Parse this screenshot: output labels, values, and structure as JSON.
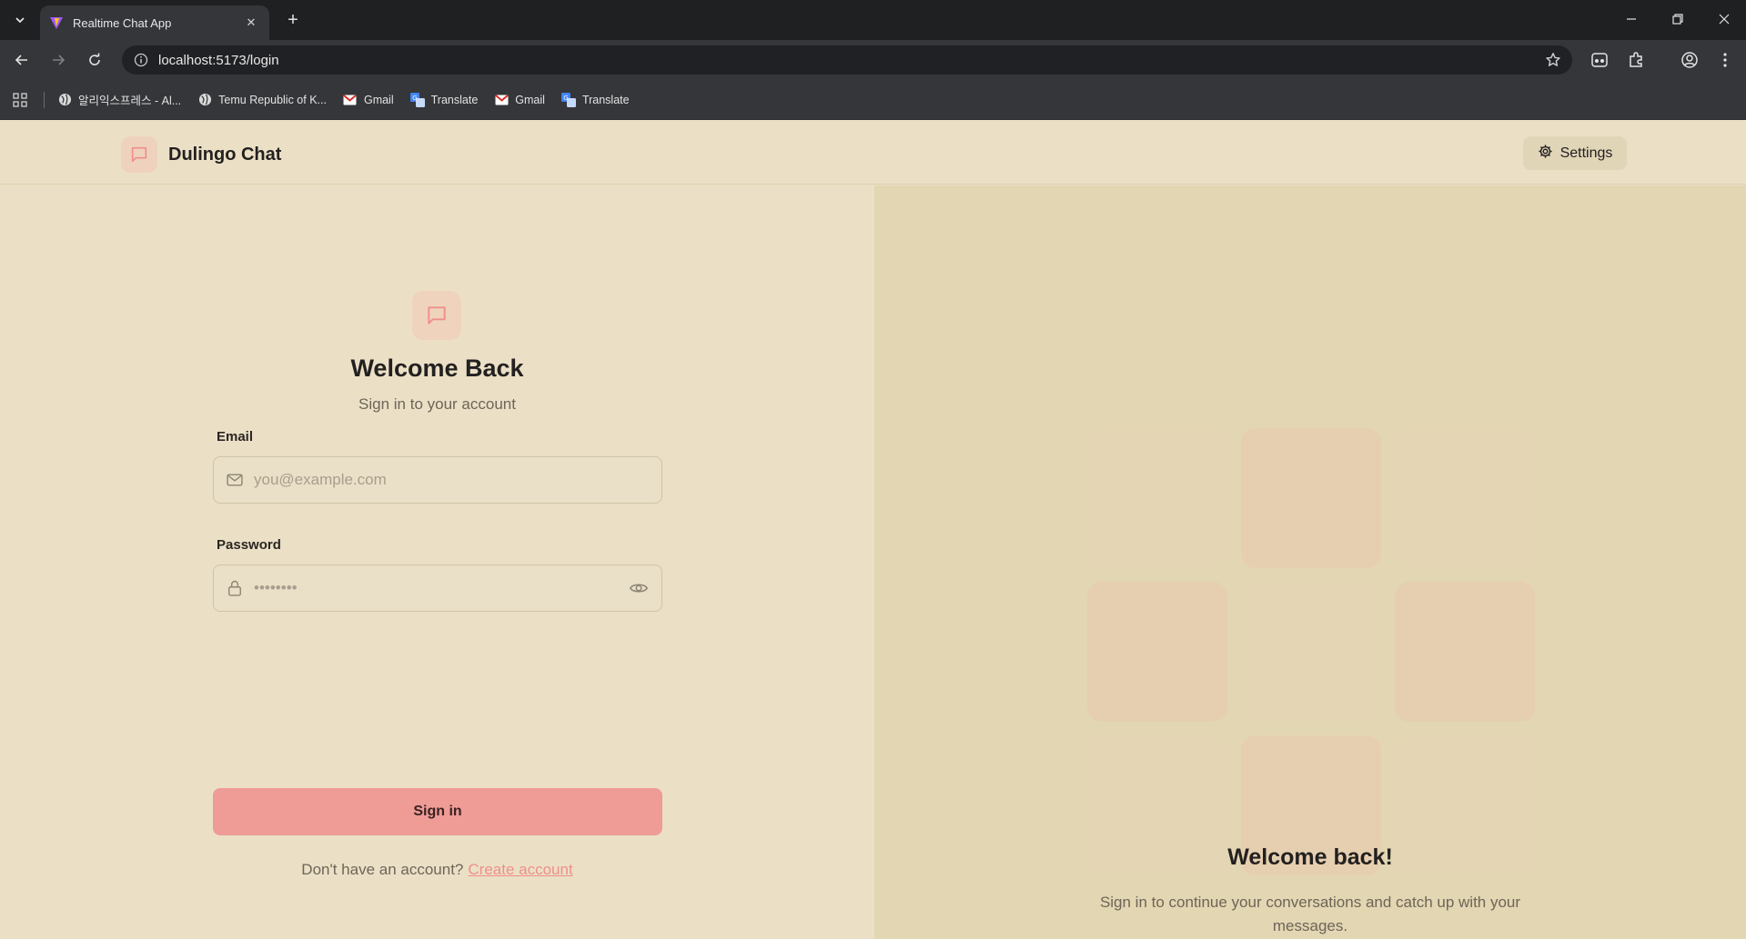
{
  "browser": {
    "tab_title": "Realtime Chat App",
    "url": "localhost:5173/login",
    "bookmarks": [
      {
        "label": "알리익스프레스 - Al...",
        "icon": "globe-icon"
      },
      {
        "label": "Temu Republic of K...",
        "icon": "globe-icon"
      },
      {
        "label": "Gmail",
        "icon": "gmail-icon"
      },
      {
        "label": "Translate",
        "icon": "translate-icon"
      },
      {
        "label": "Gmail",
        "icon": "gmail-icon"
      },
      {
        "label": "Translate",
        "icon": "translate-icon"
      }
    ]
  },
  "header": {
    "brand_name": "Dulingo Chat",
    "settings_label": "Settings"
  },
  "login": {
    "title": "Welcome Back",
    "subtitle": "Sign in to your account",
    "email_label": "Email",
    "email_placeholder": "you@example.com",
    "email_value": "",
    "password_label": "Password",
    "password_placeholder": "••••••••",
    "password_value": "",
    "submit_label": "Sign in",
    "signup_prompt": "Don't have an account?",
    "signup_link": "Create account"
  },
  "side_panel": {
    "title": "Welcome back!",
    "text": "Sign in to continue your conversations and catch up with your messages."
  },
  "colors": {
    "accent": "#ef9b96",
    "accent_link": "#ef8f8a",
    "background": "#ebe0c6",
    "panel_background": "#e3d6b2",
    "tile": "#e6cfb0"
  }
}
